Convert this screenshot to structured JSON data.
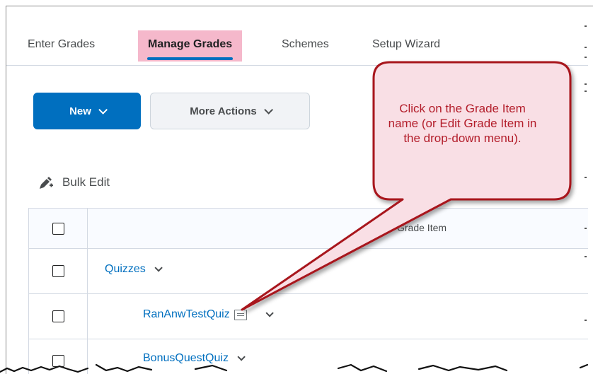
{
  "tabs": [
    {
      "label": "Enter Grades"
    },
    {
      "label": "Manage Grades"
    },
    {
      "label": "Schemes"
    },
    {
      "label": "Setup Wizard"
    }
  ],
  "toolbar": {
    "new_label": "New",
    "more_actions_label": "More Actions"
  },
  "bulk_edit": {
    "label": "Bulk Edit"
  },
  "table": {
    "header": {
      "grade_item": "Grade Item"
    },
    "rows": [
      {
        "name": "Quizzes"
      },
      {
        "name": "RanAnwTestQuiz"
      },
      {
        "name": "BonusQuestQuiz"
      }
    ]
  },
  "callout": {
    "text": "Click on the Grade Item name (or Edit Grade Item in the drop-down menu)."
  },
  "colors": {
    "accent": "#006fbf",
    "active_tab_highlight": "#f5b8cb",
    "callout_border": "#a8141f",
    "callout_text": "#b31d2a"
  },
  "icons": [
    "chevron-down-icon",
    "bulk-edit-icon",
    "checkbox-icon",
    "preview-icon"
  ]
}
